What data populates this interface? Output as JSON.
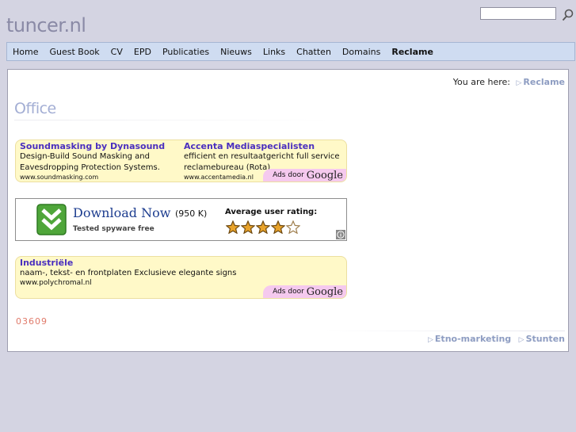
{
  "site": {
    "logo": "tuncer.nl"
  },
  "search": {
    "value": ""
  },
  "nav": {
    "items": [
      {
        "label": "Home"
      },
      {
        "label": "Guest Book"
      },
      {
        "label": "CV"
      },
      {
        "label": "EPD"
      },
      {
        "label": "Publicaties"
      },
      {
        "label": "Nieuws"
      },
      {
        "label": "Links"
      },
      {
        "label": "Chatten"
      },
      {
        "label": "Domains"
      },
      {
        "label": "Reclame"
      }
    ],
    "active": "Reclame"
  },
  "breadcrumb": {
    "prefix": "You are here:",
    "current": "Reclame"
  },
  "page": {
    "title": "Office"
  },
  "ads1": {
    "left": {
      "title": "Soundmasking by Dynasound",
      "line1": "Design-Build Sound Masking and",
      "line2": "Eavesdropping Protection Systems.",
      "url": "www.soundmasking.com"
    },
    "right": {
      "title": "Accenta Mediaspecialisten",
      "line1": "efficient en resultaatgericht full service",
      "line2": "reclamebureau (Rota)",
      "url": "www.accentamedia.nl"
    },
    "badge_prefix": "Ads door",
    "badge_brand": "Google"
  },
  "download": {
    "title": "Download Now",
    "size": "(950 K)",
    "subtitle": "Tested spyware free",
    "rating_label": "Average user rating:",
    "rating": 4,
    "rating_max": 5
  },
  "ads2": {
    "title": "Industriële",
    "line1": "naam-, tekst- en frontplaten Exclusieve elegante signs",
    "url": "www.polychromal.nl",
    "badge_prefix": "Ads door",
    "badge_brand": "Google"
  },
  "counter": "03609",
  "footer": {
    "links": [
      "Etno-marketing",
      "Stunten"
    ]
  },
  "colors": {
    "background": "#d4d4e2",
    "nav": "#cfdcf1",
    "ad_bg": "#fff9c8",
    "link_accent": "#8e9dc2",
    "ad_title": "#4a2fbf"
  }
}
